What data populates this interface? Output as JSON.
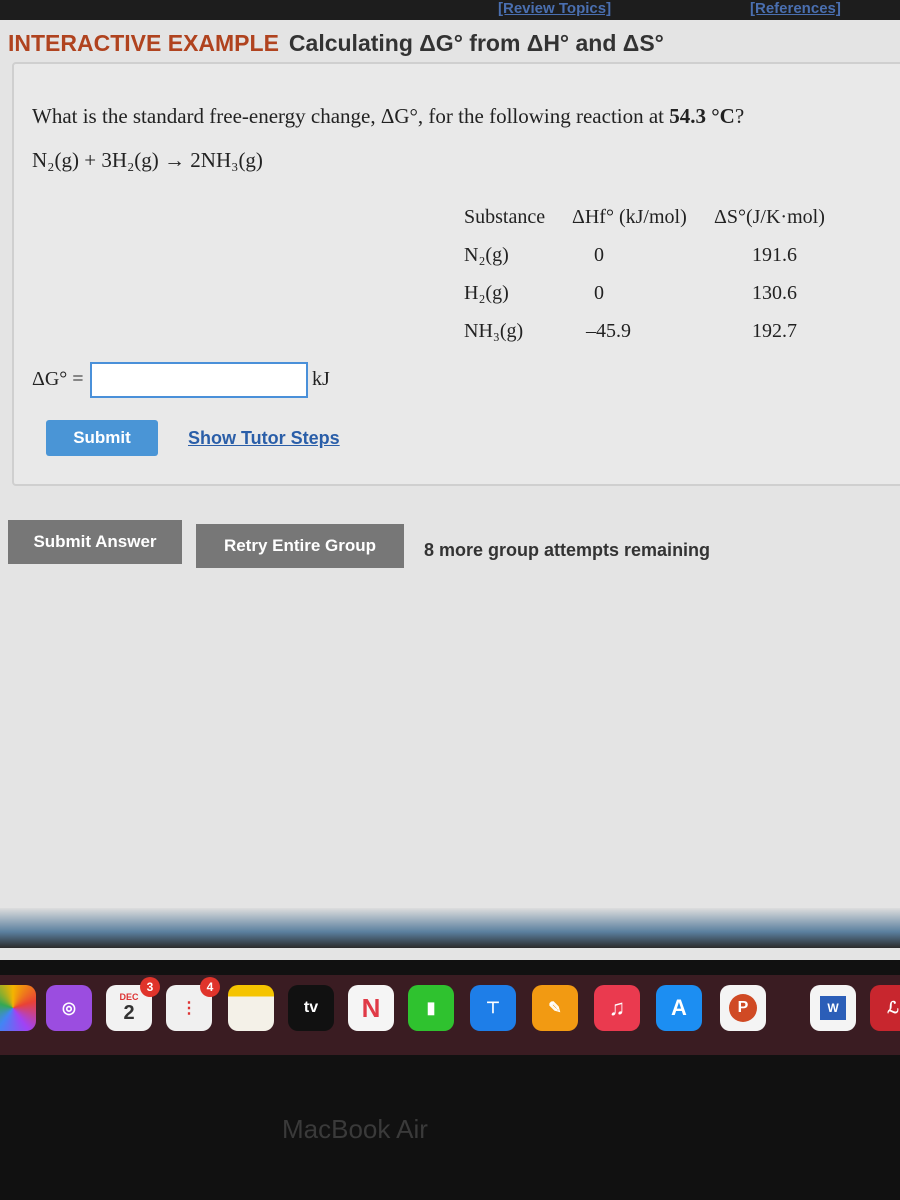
{
  "top_links": {
    "review": "[Review Topics]",
    "references": "[References]"
  },
  "heading": {
    "tag": "INTERACTIVE EXAMPLE",
    "title": "Calculating ΔG° from ΔH° and ΔS°"
  },
  "question": {
    "text_before": "What is the standard free-energy change, ΔG°, for the following reaction at ",
    "temperature": "54.3 °C",
    "text_after": "?"
  },
  "reaction": "N₂(g) + 3H₂(g) → 2NH₃(g)",
  "table": {
    "headers": [
      "Substance",
      "ΔHf° (kJ/mol)",
      "ΔS°(J/K·mol)"
    ],
    "rows": [
      [
        "N₂(g)",
        "0",
        "191.6"
      ],
      [
        "H₂(g)",
        "0",
        "130.6"
      ],
      [
        "NH₃(g)",
        "–45.9",
        "192.7"
      ]
    ]
  },
  "answer": {
    "label": "ΔG° =",
    "value": "",
    "unit": "kJ"
  },
  "buttons": {
    "submit": "Submit",
    "tutor": "Show Tutor Steps",
    "submit_answer": "Submit Answer",
    "retry": "Retry Entire Group"
  },
  "remaining": "8 more group attempts remaining",
  "dock": {
    "calendar_month": "DEC",
    "calendar_day": "2",
    "calendar_badge": "3",
    "reminders_badge": "4",
    "tv": "tv",
    "powerpoint": "P",
    "word": "W"
  },
  "brand": "MacBook Air"
}
